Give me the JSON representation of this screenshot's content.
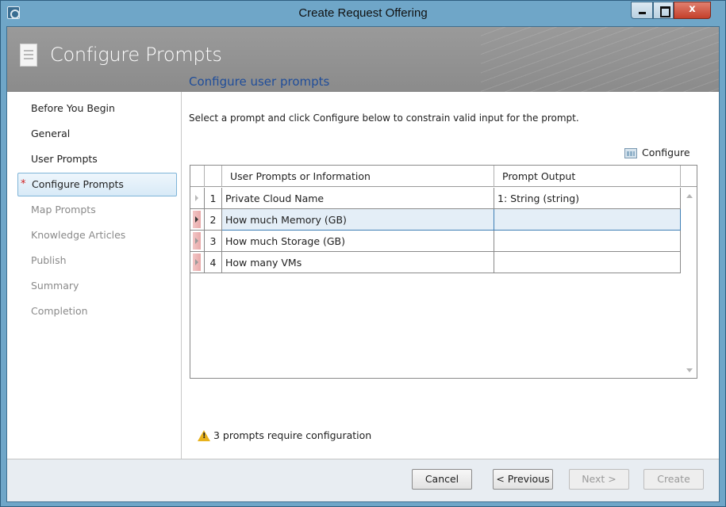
{
  "window": {
    "title": "Create Request Offering",
    "close_glyph": "x"
  },
  "banner": {
    "title": "Configure Prompts",
    "icon": "document-icon"
  },
  "nav": {
    "items": [
      {
        "label": "Before You Begin",
        "state": "normal"
      },
      {
        "label": "General",
        "state": "normal"
      },
      {
        "label": "User Prompts",
        "state": "normal"
      },
      {
        "label": "Configure Prompts",
        "state": "selected",
        "marker": "*"
      },
      {
        "label": "Map Prompts",
        "state": "disabled"
      },
      {
        "label": "Knowledge Articles",
        "state": "disabled"
      },
      {
        "label": "Publish",
        "state": "disabled"
      },
      {
        "label": "Summary",
        "state": "disabled"
      },
      {
        "label": "Completion",
        "state": "disabled"
      }
    ]
  },
  "main": {
    "heading": "Configure user prompts",
    "instructions": "Select a prompt and click Configure below to constrain valid input for the prompt.",
    "configure_label": "Configure",
    "table": {
      "columns": [
        "User Prompts or Information",
        "Prompt Output"
      ],
      "rows": [
        {
          "num": "1",
          "name": "Private Cloud Name",
          "output": "1: String (string)"
        },
        {
          "num": "2",
          "name": "How much Memory (GB)",
          "output": ""
        },
        {
          "num": "3",
          "name": "How much Storage (GB)",
          "output": ""
        },
        {
          "num": "4",
          "name": "How many VMs",
          "output": ""
        }
      ]
    },
    "warning": "3 prompts require configuration"
  },
  "footer": {
    "cancel": "Cancel",
    "previous": "< Previous",
    "next": "Next >",
    "create": "Create"
  },
  "colors": {
    "accent": "#1f4d9a",
    "title_bar": "#6fa6c8",
    "banner": "#929292",
    "required_marker": "#d02020"
  }
}
